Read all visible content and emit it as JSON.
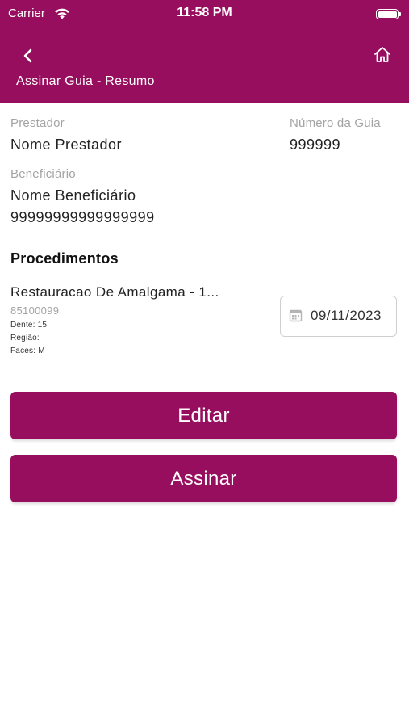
{
  "status_bar": {
    "carrier": "Carrier",
    "time": "11:58 PM"
  },
  "header": {
    "title": "Assinar Guia - Resumo",
    "back_icon": "chevron-left-icon",
    "home_icon": "home-icon",
    "color": "#970E5E"
  },
  "summary": {
    "prestador_label": "Prestador",
    "prestador_value": "Nome Prestador",
    "numero_guia_label": "Número da Guia",
    "numero_guia_value": "999999",
    "beneficiario_label": "Beneficiário",
    "beneficiario_name": "Nome Beneficiário",
    "beneficiario_number": "99999999999999999"
  },
  "procedimentos": {
    "title": "Procedimentos",
    "items": [
      {
        "name": "Restauracao De Amalgama - 1...",
        "code": "85100099",
        "dente": "Dente: 15",
        "regiao": "Região:",
        "faces": "Faces: M",
        "date": "09/11/2023"
      }
    ]
  },
  "actions": {
    "edit_label": "Editar",
    "sign_label": "Assinar"
  }
}
